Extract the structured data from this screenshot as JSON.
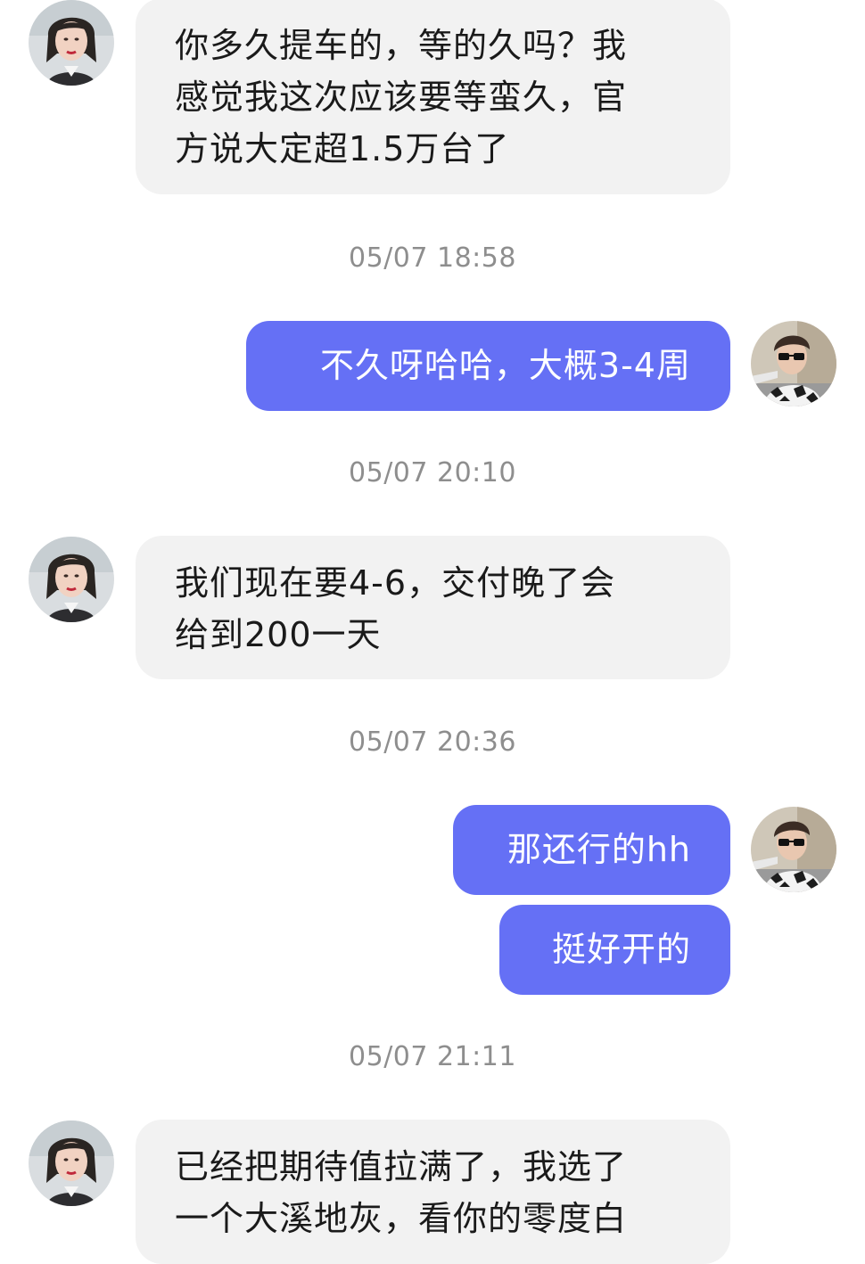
{
  "colors": {
    "background": "#ffffff",
    "incoming_bubble": "#f2f2f2",
    "outgoing_bubble": "#6570f5",
    "incoming_text": "#1a1a1a",
    "outgoing_text": "#ffffff",
    "timestamp": "#8e8e8e"
  },
  "messages": {
    "m1": {
      "sender": "other",
      "lines": [
        "你多久提车的，等的久吗？我",
        "感觉我这次应该要等蛮久，官",
        "方说大定超1.5万台了"
      ]
    },
    "t1": "05/07 18:58",
    "m2": {
      "sender": "me",
      "text": "不久呀哈哈，大概3-4周"
    },
    "t2": "05/07 20:10",
    "m3": {
      "sender": "other",
      "lines": [
        "我们现在要4-6，交付晚了会",
        "给到200一天"
      ]
    },
    "t3": "05/07 20:36",
    "m4": {
      "sender": "me",
      "text": "那还行的hh"
    },
    "m5": {
      "sender": "me",
      "text": "挺好开的"
    },
    "t4": "05/07 21:11",
    "m6": {
      "sender": "other",
      "lines": [
        "已经把期待值拉满了，我选了",
        "一个大溪地灰，看你的零度白"
      ]
    }
  },
  "avatars": {
    "other": "avatar-woman-photo",
    "me": "avatar-man-sunglasses-photo"
  }
}
